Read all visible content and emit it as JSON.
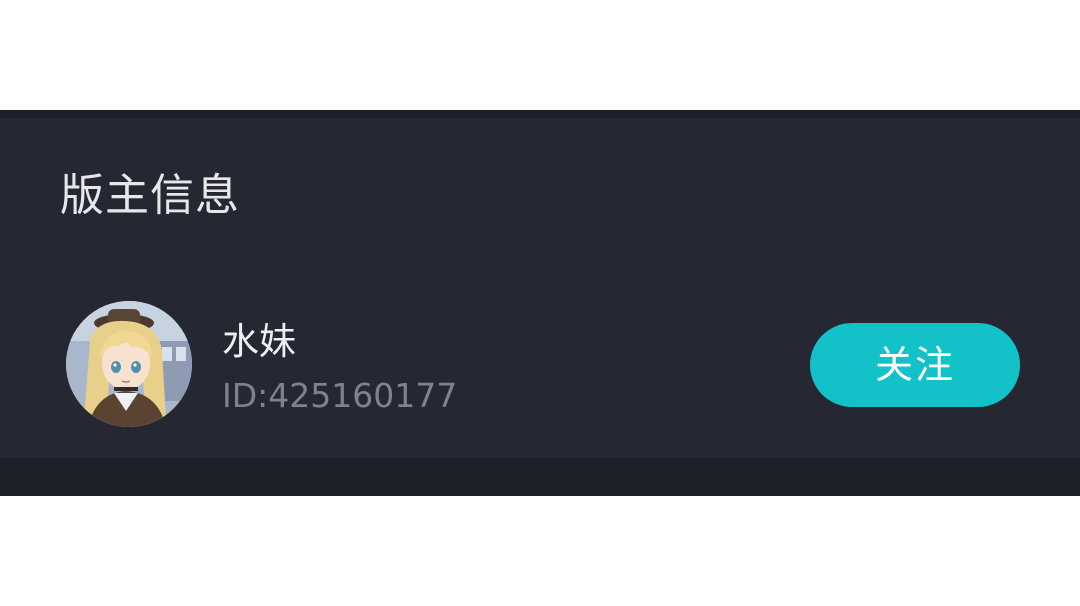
{
  "section": {
    "title": "版主信息"
  },
  "moderator": {
    "name": "水妹",
    "id_text": "ID:425160177",
    "avatar_icon": "avatar-anime-girl"
  },
  "actions": {
    "follow_label": "关注"
  },
  "colors": {
    "card_background": "#252833",
    "bar_background": "#1d2028",
    "accent": "#13c2c9",
    "title_text": "#e6e7ea",
    "id_text": "#7c8290"
  }
}
